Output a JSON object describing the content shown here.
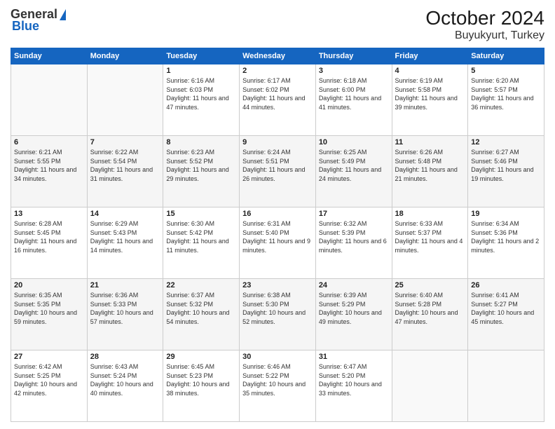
{
  "header": {
    "logo": {
      "general": "General",
      "blue": "Blue"
    },
    "title": "October 2024",
    "location": "Buyukyurt, Turkey"
  },
  "weekdays": [
    "Sunday",
    "Monday",
    "Tuesday",
    "Wednesday",
    "Thursday",
    "Friday",
    "Saturday"
  ],
  "weeks": [
    [
      null,
      null,
      {
        "day": 1,
        "sunrise": "6:16 AM",
        "sunset": "6:03 PM",
        "daylight": "11 hours and 47 minutes."
      },
      {
        "day": 2,
        "sunrise": "6:17 AM",
        "sunset": "6:02 PM",
        "daylight": "11 hours and 44 minutes."
      },
      {
        "day": 3,
        "sunrise": "6:18 AM",
        "sunset": "6:00 PM",
        "daylight": "11 hours and 41 minutes."
      },
      {
        "day": 4,
        "sunrise": "6:19 AM",
        "sunset": "5:58 PM",
        "daylight": "11 hours and 39 minutes."
      },
      {
        "day": 5,
        "sunrise": "6:20 AM",
        "sunset": "5:57 PM",
        "daylight": "11 hours and 36 minutes."
      }
    ],
    [
      {
        "day": 6,
        "sunrise": "6:21 AM",
        "sunset": "5:55 PM",
        "daylight": "11 hours and 34 minutes."
      },
      {
        "day": 7,
        "sunrise": "6:22 AM",
        "sunset": "5:54 PM",
        "daylight": "11 hours and 31 minutes."
      },
      {
        "day": 8,
        "sunrise": "6:23 AM",
        "sunset": "5:52 PM",
        "daylight": "11 hours and 29 minutes."
      },
      {
        "day": 9,
        "sunrise": "6:24 AM",
        "sunset": "5:51 PM",
        "daylight": "11 hours and 26 minutes."
      },
      {
        "day": 10,
        "sunrise": "6:25 AM",
        "sunset": "5:49 PM",
        "daylight": "11 hours and 24 minutes."
      },
      {
        "day": 11,
        "sunrise": "6:26 AM",
        "sunset": "5:48 PM",
        "daylight": "11 hours and 21 minutes."
      },
      {
        "day": 12,
        "sunrise": "6:27 AM",
        "sunset": "5:46 PM",
        "daylight": "11 hours and 19 minutes."
      }
    ],
    [
      {
        "day": 13,
        "sunrise": "6:28 AM",
        "sunset": "5:45 PM",
        "daylight": "11 hours and 16 minutes."
      },
      {
        "day": 14,
        "sunrise": "6:29 AM",
        "sunset": "5:43 PM",
        "daylight": "11 hours and 14 minutes."
      },
      {
        "day": 15,
        "sunrise": "6:30 AM",
        "sunset": "5:42 PM",
        "daylight": "11 hours and 11 minutes."
      },
      {
        "day": 16,
        "sunrise": "6:31 AM",
        "sunset": "5:40 PM",
        "daylight": "11 hours and 9 minutes."
      },
      {
        "day": 17,
        "sunrise": "6:32 AM",
        "sunset": "5:39 PM",
        "daylight": "11 hours and 6 minutes."
      },
      {
        "day": 18,
        "sunrise": "6:33 AM",
        "sunset": "5:37 PM",
        "daylight": "11 hours and 4 minutes."
      },
      {
        "day": 19,
        "sunrise": "6:34 AM",
        "sunset": "5:36 PM",
        "daylight": "11 hours and 2 minutes."
      }
    ],
    [
      {
        "day": 20,
        "sunrise": "6:35 AM",
        "sunset": "5:35 PM",
        "daylight": "10 hours and 59 minutes."
      },
      {
        "day": 21,
        "sunrise": "6:36 AM",
        "sunset": "5:33 PM",
        "daylight": "10 hours and 57 minutes."
      },
      {
        "day": 22,
        "sunrise": "6:37 AM",
        "sunset": "5:32 PM",
        "daylight": "10 hours and 54 minutes."
      },
      {
        "day": 23,
        "sunrise": "6:38 AM",
        "sunset": "5:30 PM",
        "daylight": "10 hours and 52 minutes."
      },
      {
        "day": 24,
        "sunrise": "6:39 AM",
        "sunset": "5:29 PM",
        "daylight": "10 hours and 49 minutes."
      },
      {
        "day": 25,
        "sunrise": "6:40 AM",
        "sunset": "5:28 PM",
        "daylight": "10 hours and 47 minutes."
      },
      {
        "day": 26,
        "sunrise": "6:41 AM",
        "sunset": "5:27 PM",
        "daylight": "10 hours and 45 minutes."
      }
    ],
    [
      {
        "day": 27,
        "sunrise": "6:42 AM",
        "sunset": "5:25 PM",
        "daylight": "10 hours and 42 minutes."
      },
      {
        "day": 28,
        "sunrise": "6:43 AM",
        "sunset": "5:24 PM",
        "daylight": "10 hours and 40 minutes."
      },
      {
        "day": 29,
        "sunrise": "6:45 AM",
        "sunset": "5:23 PM",
        "daylight": "10 hours and 38 minutes."
      },
      {
        "day": 30,
        "sunrise": "6:46 AM",
        "sunset": "5:22 PM",
        "daylight": "10 hours and 35 minutes."
      },
      {
        "day": 31,
        "sunrise": "6:47 AM",
        "sunset": "5:20 PM",
        "daylight": "10 hours and 33 minutes."
      },
      null,
      null
    ]
  ]
}
